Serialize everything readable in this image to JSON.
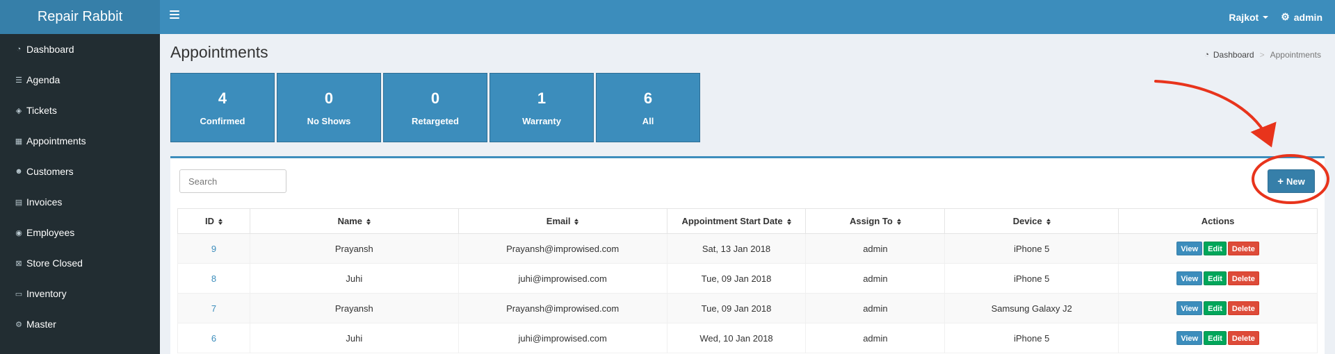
{
  "app": {
    "title": "Repair Rabbit"
  },
  "topbar": {
    "location": "Rajkot",
    "user": "admin"
  },
  "sidebar": {
    "items": [
      {
        "label": "Dashboard",
        "icon": "dashboard-icon",
        "glyph": "◔"
      },
      {
        "label": "Agenda",
        "icon": "list-icon",
        "glyph": "☰"
      },
      {
        "label": "Tickets",
        "icon": "tag-icon",
        "glyph": "◈"
      },
      {
        "label": "Appointments",
        "icon": "calendar-icon",
        "glyph": "▦"
      },
      {
        "label": "Customers",
        "icon": "users-icon",
        "glyph": "☻"
      },
      {
        "label": "Invoices",
        "icon": "file-icon",
        "glyph": "▤"
      },
      {
        "label": "Employees",
        "icon": "user-circle-icon",
        "glyph": "◉"
      },
      {
        "label": "Store Closed",
        "icon": "calendar-times-icon",
        "glyph": "⊠"
      },
      {
        "label": "Inventory",
        "icon": "keyboard-icon",
        "glyph": "▭"
      },
      {
        "label": "Master",
        "icon": "cogs-icon",
        "glyph": "⚙"
      }
    ]
  },
  "page": {
    "title": "Appointments",
    "breadcrumb": {
      "home": "Dashboard",
      "sep": ">",
      "current": "Appointments"
    }
  },
  "stats": [
    {
      "count": "4",
      "label": "Confirmed"
    },
    {
      "count": "0",
      "label": "No Shows"
    },
    {
      "count": "0",
      "label": "Retargeted"
    },
    {
      "count": "1",
      "label": "Warranty"
    },
    {
      "count": "6",
      "label": "All"
    }
  ],
  "search": {
    "placeholder": "Search"
  },
  "new_button": {
    "label": "New"
  },
  "table": {
    "headers": [
      "ID",
      "Name",
      "Email",
      "Appointment Start Date",
      "Assign To",
      "Device",
      "Actions"
    ],
    "rows": [
      {
        "id": "9",
        "name": "Prayansh",
        "email": "Prayansh@improwised.com",
        "date": "Sat, 13 Jan 2018",
        "assign": "admin",
        "device": "iPhone 5"
      },
      {
        "id": "8",
        "name": "Juhi",
        "email": "juhi@improwised.com",
        "date": "Tue, 09 Jan 2018",
        "assign": "admin",
        "device": "iPhone 5"
      },
      {
        "id": "7",
        "name": "Prayansh",
        "email": "Prayansh@improwised.com",
        "date": "Tue, 09 Jan 2018",
        "assign": "admin",
        "device": "Samsung Galaxy J2"
      },
      {
        "id": "6",
        "name": "Juhi",
        "email": "juhi@improwised.com",
        "date": "Wed, 10 Jan 2018",
        "assign": "admin",
        "device": "iPhone 5"
      }
    ],
    "actions": {
      "view": "View",
      "edit": "Edit",
      "delete": "Delete"
    }
  },
  "colors": {
    "primary": "#3c8dbc",
    "sidebar": "#222d32",
    "success": "#00a65a",
    "danger": "#dd4b39",
    "annotation": "#e8341c"
  }
}
